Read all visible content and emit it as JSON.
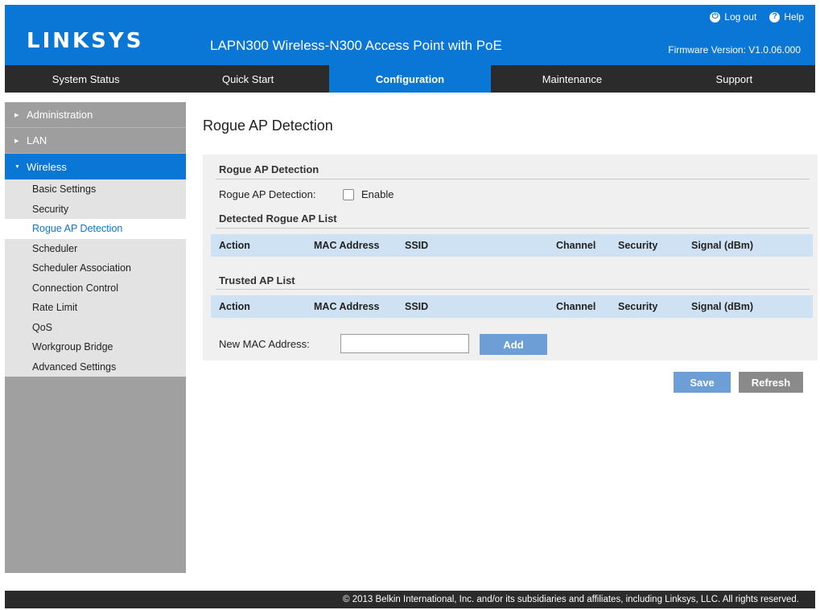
{
  "header": {
    "logo": "LINKSYS",
    "product_title": "LAPN300 Wireless-N300 Access Point with PoE",
    "logout": "Log out",
    "help": "Help",
    "firmware": "Firmware Version: V1.0.06.000",
    "color": "#0a76d6"
  },
  "nav": {
    "tabs": [
      {
        "label": "System Status"
      },
      {
        "label": "Quick Start"
      },
      {
        "label": "Configuration"
      },
      {
        "label": "Maintenance"
      },
      {
        "label": "Support"
      }
    ],
    "active": "Configuration"
  },
  "sidebar": {
    "groups": [
      {
        "label": "Administration"
      },
      {
        "label": "LAN"
      },
      {
        "label": "Wireless"
      }
    ],
    "wireless_items": [
      {
        "label": "Basic Settings"
      },
      {
        "label": "Security"
      },
      {
        "label": "Rogue AP Detection"
      },
      {
        "label": "Scheduler"
      },
      {
        "label": "Scheduler Association"
      },
      {
        "label": "Connection Control"
      },
      {
        "label": "Rate Limit"
      },
      {
        "label": "QoS"
      },
      {
        "label": "Workgroup Bridge"
      },
      {
        "label": "Advanced Settings"
      }
    ],
    "active_item": "Rogue AP Detection"
  },
  "main": {
    "page_title": "Rogue AP Detection",
    "section1_title": "Rogue AP Detection",
    "detection_label": "Rogue AP Detection:",
    "enable_label": "Enable",
    "enable_checked": false,
    "detected_list_title": "Detected Rogue AP List",
    "trusted_list_title": "Trusted AP List",
    "columns": [
      "Action",
      "MAC Address",
      "SSID",
      "Channel",
      "Security",
      "Signal (dBm)"
    ],
    "new_mac_label": "New MAC Address:",
    "new_mac_value": "",
    "add_button": "Add",
    "save_button": "Save",
    "refresh_button": "Refresh"
  },
  "footer": {
    "copyright": "© 2013 Belkin International, Inc. and/or its subsidiaries and affiliates, including Linksys, LLC. All rights reserved."
  }
}
